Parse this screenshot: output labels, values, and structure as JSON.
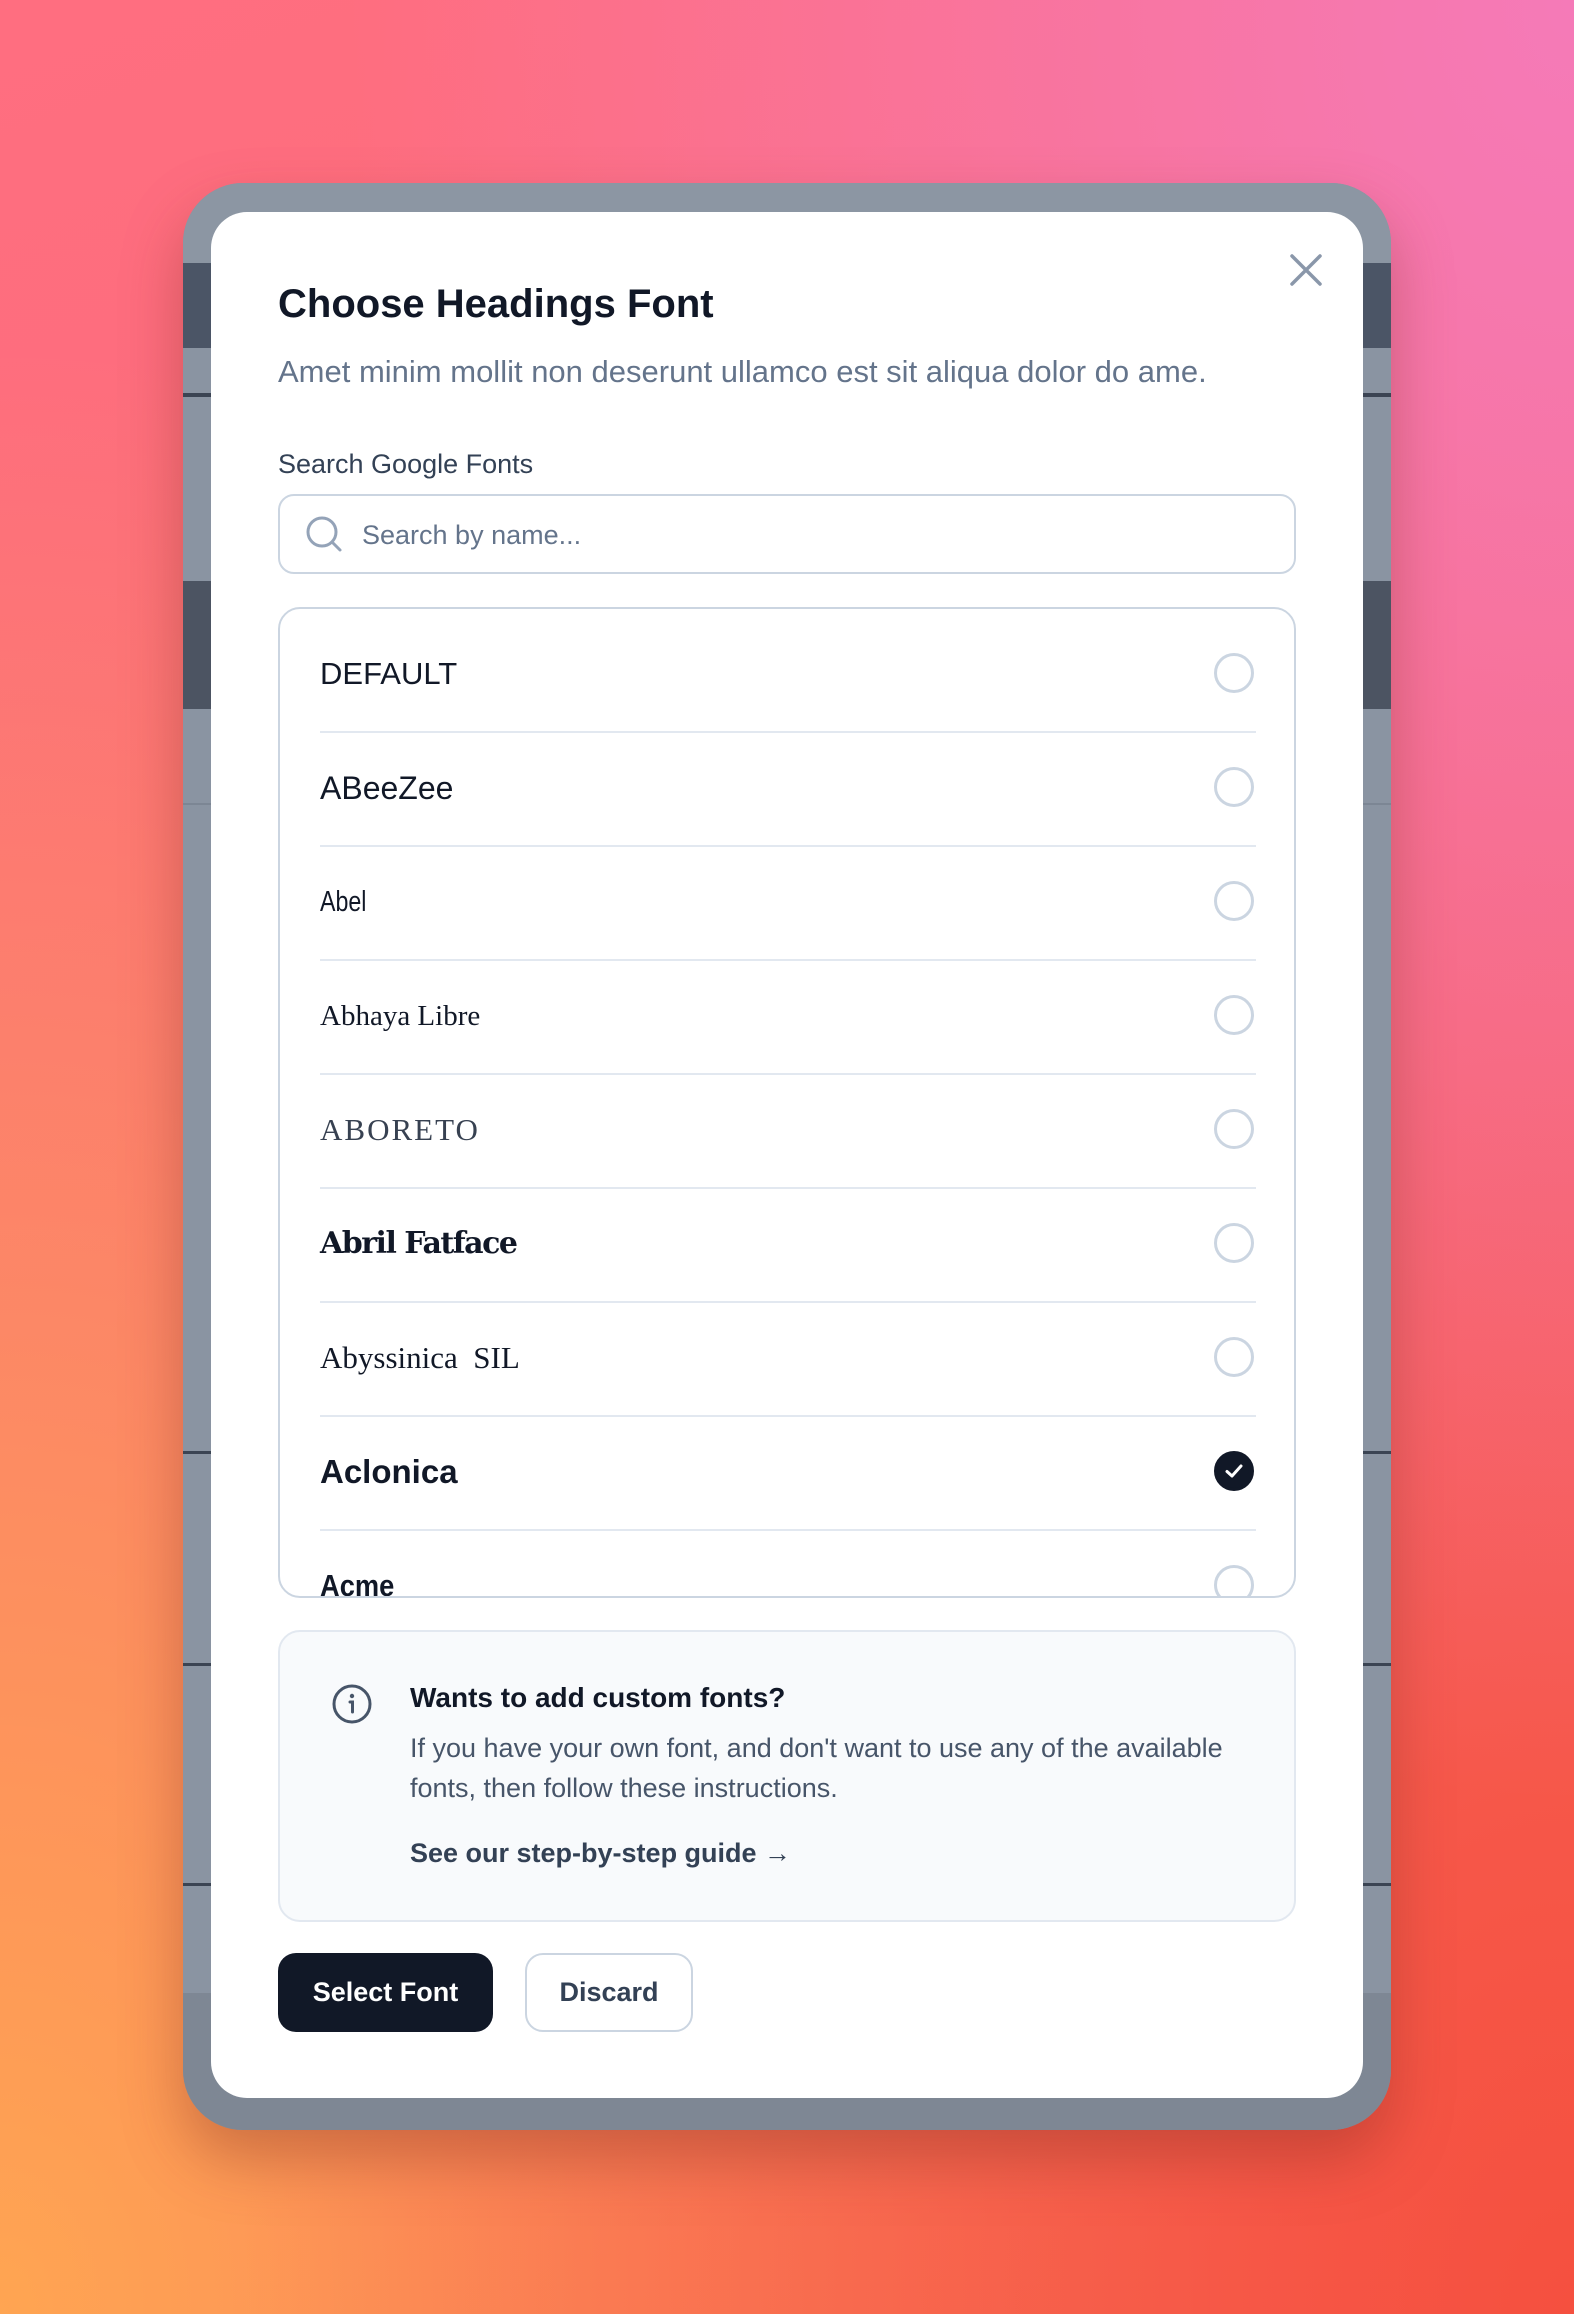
{
  "modal": {
    "title": "Choose Headings Font",
    "subtitle": "Amet minim mollit non deserunt ullamco est sit aliqua dolor do ame.",
    "close_icon": "x-icon"
  },
  "search": {
    "label": "Search Google Fonts",
    "placeholder": "Search by name...",
    "value": ""
  },
  "fonts": [
    {
      "name": "DEFAULT",
      "selected": false
    },
    {
      "name": "ABeeZee",
      "selected": false
    },
    {
      "name": "Abel",
      "selected": false
    },
    {
      "name": "Abhaya Libre",
      "selected": false
    },
    {
      "name": "ABORETO",
      "selected": false
    },
    {
      "name": "Abril Fatface",
      "selected": false
    },
    {
      "name": "Abyssinica  SIL",
      "selected": false
    },
    {
      "name": "Aclonica",
      "selected": true
    },
    {
      "name": "Acme",
      "selected": false
    }
  ],
  "info": {
    "icon": "info-icon",
    "title": "Wants to add custom fonts?",
    "text": "If you have your own font, and don't want to use any of the available fonts, then follow these instructions.",
    "link": "See our step-by-step guide →"
  },
  "actions": {
    "primary": "Select Font",
    "secondary": "Discard"
  },
  "colors": {
    "primary": "#111827",
    "border": "#cbd5e1",
    "muted": "#64748b"
  }
}
